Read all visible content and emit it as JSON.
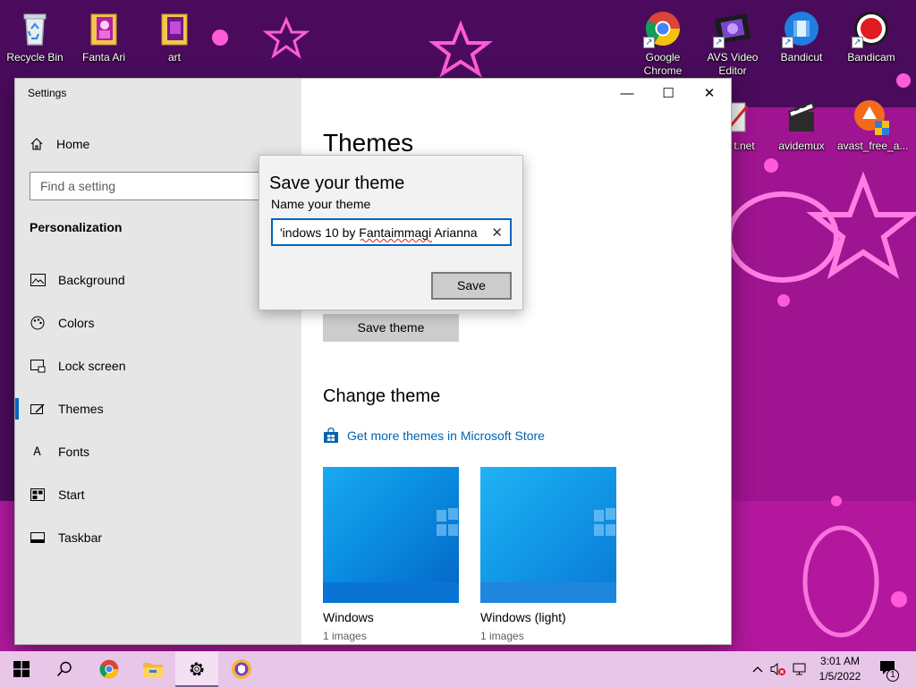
{
  "desktop": {
    "left_icons": [
      {
        "label": "Recycle Bin",
        "icon": "recycle-bin-icon"
      },
      {
        "label": "Fanta Ari",
        "icon": "folder-icon"
      },
      {
        "label": "art",
        "icon": "folder-icon"
      }
    ],
    "right_icons_row1": [
      {
        "label": "Google Chrome",
        "icon": "chrome-icon"
      },
      {
        "label": "AVS Video Editor",
        "icon": "avs-video-editor-icon"
      },
      {
        "label": "Bandicut",
        "icon": "bandicut-icon"
      },
      {
        "label": "Bandicam",
        "icon": "bandicam-icon"
      }
    ],
    "right_icons_row2": [
      {
        "label": "t.net",
        "icon": "paint-net-icon"
      },
      {
        "label": "avidemux",
        "icon": "avidemux-icon"
      },
      {
        "label": "avast_free_a...",
        "icon": "avast-icon"
      }
    ]
  },
  "window": {
    "title": "Settings",
    "minimize": "—",
    "maximize": "☐",
    "close": "✕"
  },
  "sidebar": {
    "home": "Home",
    "search_placeholder": "Find a setting",
    "section": "Personalization",
    "items": [
      {
        "label": "Background",
        "icon": "background-icon"
      },
      {
        "label": "Colors",
        "icon": "colors-icon"
      },
      {
        "label": "Lock screen",
        "icon": "lock-screen-icon"
      },
      {
        "label": "Themes",
        "icon": "themes-icon",
        "active": true
      },
      {
        "label": "Fonts",
        "icon": "fonts-icon"
      },
      {
        "label": "Start",
        "icon": "start-icon"
      },
      {
        "label": "Taskbar",
        "icon": "taskbar-icon"
      }
    ]
  },
  "main": {
    "heading": "Themes",
    "save_theme_button": "Save theme",
    "change_theme_heading": "Change theme",
    "store_link": "Get more themes in Microsoft Store",
    "themes": [
      {
        "name": "Windows",
        "count": "1 images"
      },
      {
        "name": "Windows (light)",
        "count": "1 images"
      }
    ]
  },
  "dialog": {
    "title": "Save your theme",
    "label": "Name your theme",
    "input_value": "'indows 10 by Fantaimmagi Arianna",
    "clear": "✕",
    "save_button": "Save"
  },
  "taskbar": {
    "time": "3:01 AM",
    "date": "1/5/2022",
    "notification_count": "1"
  },
  "colors": {
    "accent": "#0067c0",
    "link": "#0063b1",
    "taskbar": "#e7c6e8",
    "wallpaper": "#5a0f6e"
  }
}
